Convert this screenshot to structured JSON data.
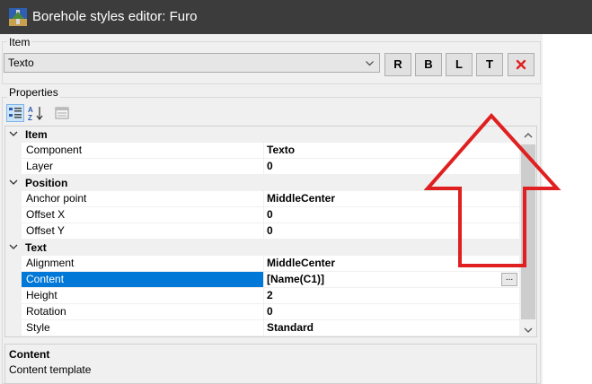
{
  "window": {
    "title": "Borehole styles editor: Furo"
  },
  "item_group": {
    "label": "Item",
    "selected_item": "Texto",
    "buttons": [
      {
        "label": "R"
      },
      {
        "label": "B"
      },
      {
        "label": "L"
      },
      {
        "label": "T"
      }
    ],
    "delete_icon": "close-x-icon"
  },
  "properties_group": {
    "label": "Properties",
    "toolbar": [
      "categorized-icon",
      "alphabetical-sort-icon",
      "property-pages-icon"
    ]
  },
  "property_grid": {
    "categories": [
      {
        "label": "Item",
        "properties": [
          {
            "name": "Component",
            "value": "Texto"
          },
          {
            "name": "Layer",
            "value": "0"
          }
        ]
      },
      {
        "label": "Position",
        "properties": [
          {
            "name": "Anchor point",
            "value": "MiddleCenter"
          },
          {
            "name": "Offset X",
            "value": "0"
          },
          {
            "name": "Offset Y",
            "value": "0"
          }
        ]
      },
      {
        "label": "Text",
        "properties": [
          {
            "name": "Alignment",
            "value": "MiddleCenter"
          },
          {
            "name": "Content",
            "value": "[Name(C1)]",
            "selected": true,
            "ellipsis": "..."
          },
          {
            "name": "Height",
            "value": "2"
          },
          {
            "name": "Rotation",
            "value": "0"
          },
          {
            "name": "Style",
            "value": "Standard"
          }
        ]
      }
    ]
  },
  "description": {
    "title": "Content",
    "text": "Content template"
  },
  "colors": {
    "titlebar": "#3c3c3c",
    "selection": "#0078d7",
    "annotation_arrow": "#e02020",
    "delete_icon": "#e02020"
  }
}
